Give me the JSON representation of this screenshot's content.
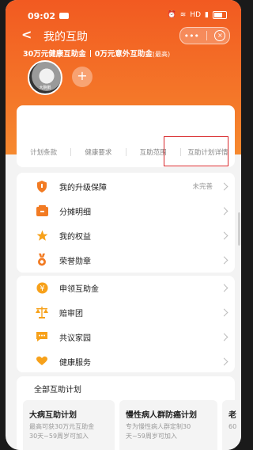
{
  "status_bar": {
    "time": "09:02",
    "hd": "HD",
    "battery": "82"
  },
  "nav": {
    "title": "我的互助",
    "more": "•••",
    "close": "×"
  },
  "summary": {
    "health": "30万元健康互助金",
    "accident": "0万元意外互助金",
    "max_note": "(最高)"
  },
  "avatar": {
    "caption": "大碗鹅"
  },
  "tabs": [
    {
      "label": "计划条款"
    },
    {
      "label": "健康要求"
    },
    {
      "label": "互助范围"
    },
    {
      "label": "互助计划详情"
    }
  ],
  "menu_group1": [
    {
      "label": "我的升级保障",
      "value": "未完善",
      "icon": "shield-icon",
      "color": "#f27b23"
    },
    {
      "label": "分摊明细",
      "value": "",
      "icon": "wallet-icon",
      "color": "#f27b23"
    },
    {
      "label": "我的权益",
      "value": "",
      "icon": "star-icon",
      "color": "#f7a11a"
    },
    {
      "label": "荣誉勋章",
      "value": "",
      "icon": "medal-icon",
      "color": "#f27b23"
    }
  ],
  "menu_group2": [
    {
      "label": "申领互助金",
      "value": "",
      "icon": "yen-icon",
      "color": "#f7a11a"
    },
    {
      "label": "赔审团",
      "value": "",
      "icon": "scale-icon",
      "color": "#f7a11a"
    },
    {
      "label": "共议家园",
      "value": "",
      "icon": "chat-icon",
      "color": "#f7a11a"
    },
    {
      "label": "健康服务",
      "value": "",
      "icon": "heart-hand-icon",
      "color": "#f7a11a"
    }
  ],
  "plans": {
    "heading": "全部互助计划",
    "items": [
      {
        "title": "大病互助计划",
        "line1": "最高可获30万元互助金",
        "line2": "30天~59周岁可加入"
      },
      {
        "title": "慢性病人群防癌计划",
        "line1": "专为慢性病人群定制30",
        "line2": "天~59周岁可加入"
      },
      {
        "title": "老",
        "line1": "60",
        "line2": ""
      }
    ]
  },
  "colors": {
    "accent": "#f25a21",
    "highlight_box": "#d8272a"
  }
}
